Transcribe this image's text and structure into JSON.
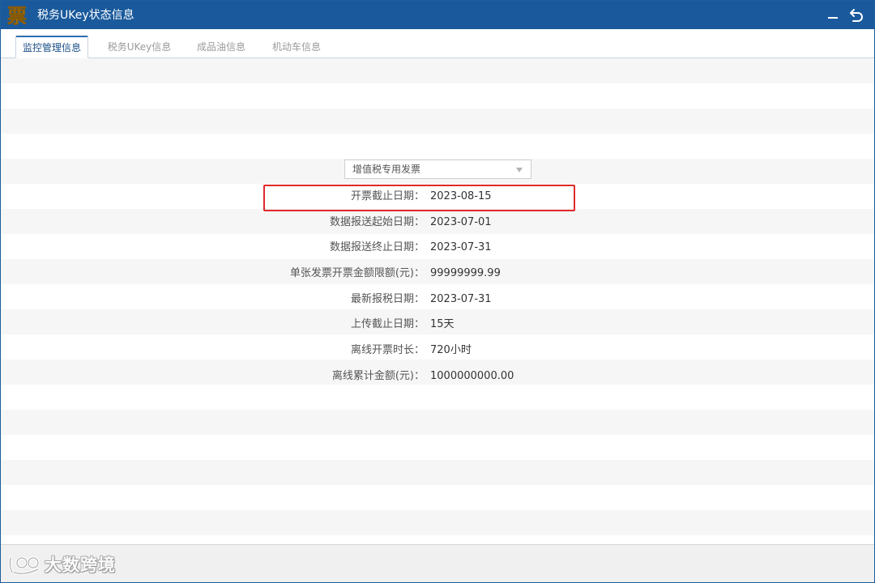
{
  "window": {
    "title": "税务UKey状态信息",
    "logo_char": "票"
  },
  "tabs": [
    {
      "label": "监控管理信息",
      "active": true
    },
    {
      "label": "税务UKey信息",
      "active": false
    },
    {
      "label": "成品油信息",
      "active": false
    },
    {
      "label": "机动车信息",
      "active": false
    }
  ],
  "invoice_type_select": {
    "value": "增值税专用发票"
  },
  "info_rows": [
    {
      "label": "开票截止日期：",
      "value": "2023-08-15",
      "highlighted": true
    },
    {
      "label": "数据报送起始日期：",
      "value": "2023-07-01"
    },
    {
      "label": "数据报送终止日期：",
      "value": "2023-07-31"
    },
    {
      "label": "单张发票开票金额限额(元)：",
      "value": "99999999.99"
    },
    {
      "label": "最新报税日期：",
      "value": "2023-07-31"
    },
    {
      "label": "上传截止日期：",
      "value": "15天"
    },
    {
      "label": "离线开票时长：",
      "value": "720小时"
    },
    {
      "label": "离线累计金额(元)：",
      "value": "1000000000.00"
    }
  ],
  "watermark": {
    "text": "大数跨境"
  },
  "colors": {
    "titlebar": "#1a5a9c",
    "highlight": "#e0292a",
    "logo_gold": "#f2b418"
  },
  "icons": {
    "minimize": "minimize-icon",
    "back": "back-arrow-icon"
  }
}
